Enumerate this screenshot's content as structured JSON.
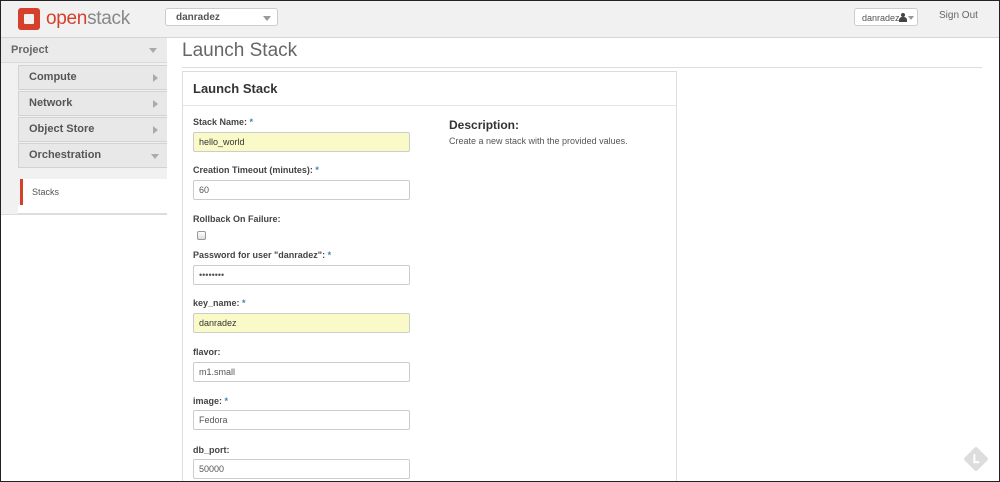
{
  "header": {
    "logo": {
      "open": "open",
      "stack": "stack"
    },
    "project_selector": "danradez",
    "user_menu": "danradez",
    "sign_out": "Sign Out"
  },
  "sidebar": {
    "section": "Project",
    "items": [
      {
        "label": "Compute",
        "icon": "chevron-right-icon"
      },
      {
        "label": "Network",
        "icon": "chevron-right-icon"
      },
      {
        "label": "Object Store",
        "icon": "chevron-right-icon"
      },
      {
        "label": "Orchestration",
        "icon": "chevron-down-icon"
      }
    ],
    "active_subitem": "Stacks"
  },
  "page": {
    "title": "Launch Stack"
  },
  "form": {
    "title": "Launch Stack",
    "fields": [
      {
        "label": "Stack Name:",
        "required": "*",
        "value": "hello_world"
      },
      {
        "label": "Creation Timeout (minutes):",
        "required": "*",
        "value": "60"
      },
      {
        "label": "Rollback On Failure:"
      },
      {
        "label": "Password for user \"danradez\":",
        "required": "*",
        "value": "••••••••"
      },
      {
        "label": "key_name:",
        "required": "*",
        "value": "danradez"
      },
      {
        "label": "flavor:",
        "value": "m1.small"
      },
      {
        "label": "image:",
        "required": "*",
        "value": "Fedora"
      },
      {
        "label": "db_port:",
        "value": "50000"
      }
    ],
    "description_heading": "Description:",
    "description_text": "Create a new stack with the provided values."
  },
  "colors": {
    "brand": "#d53f2c",
    "required": "#3a87ad",
    "autofill": "#fafac9"
  }
}
